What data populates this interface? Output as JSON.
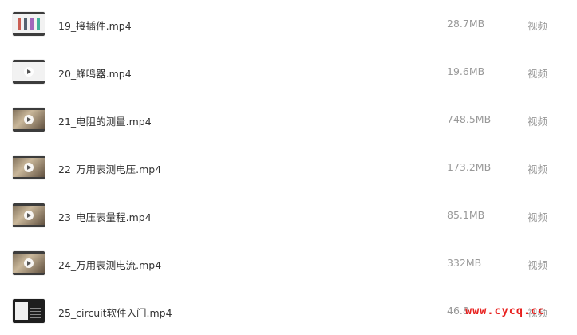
{
  "files": [
    {
      "name": "19_接插件.mp4",
      "size": "28.7MB",
      "type": "视频",
      "thumb_icon": "video-thumbnail-slides"
    },
    {
      "name": "20_蜂鸣器.mp4",
      "size": "19.6MB",
      "type": "视频",
      "thumb_icon": "video-thumbnail-slides"
    },
    {
      "name": "21_电阻的测量.mp4",
      "size": "748.5MB",
      "type": "视频",
      "thumb_icon": "video-thumbnail-photo"
    },
    {
      "name": "22_万用表测电压.mp4",
      "size": "173.2MB",
      "type": "视频",
      "thumb_icon": "video-thumbnail-photo"
    },
    {
      "name": "23_电压表量程.mp4",
      "size": "85.1MB",
      "type": "视频",
      "thumb_icon": "video-thumbnail-photo"
    },
    {
      "name": "24_万用表测电流.mp4",
      "size": "332MB",
      "type": "视频",
      "thumb_icon": "video-thumbnail-photo"
    },
    {
      "name": "25_circuit软件入门.mp4",
      "size": "46.8",
      "type": "视频",
      "thumb_icon": "video-thumbnail-screen"
    }
  ],
  "watermark": "www.cycq.cc",
  "colors": {
    "filename": "#333333",
    "meta": "#999999",
    "watermark": "#e8201e"
  }
}
